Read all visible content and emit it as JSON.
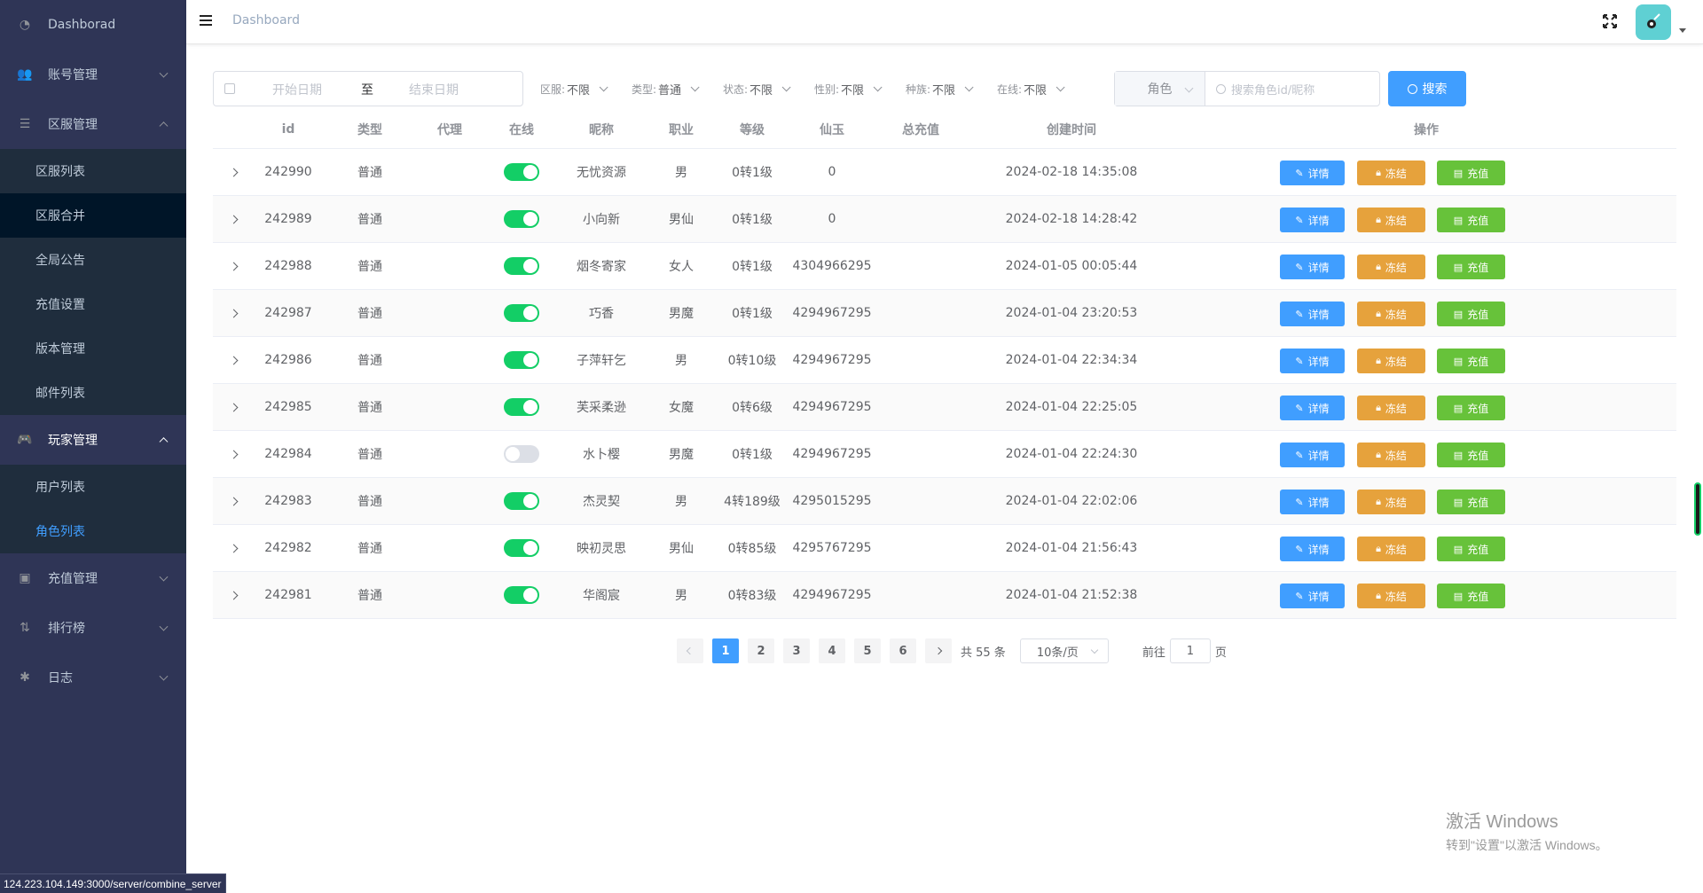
{
  "sidebar": {
    "items": [
      {
        "label": "Dashborad",
        "icon": "dashboard-icon"
      },
      {
        "label": "账号管理",
        "icon": "users-icon"
      },
      {
        "label": "区服管理",
        "icon": "server-icon"
      },
      {
        "label": "玩家管理",
        "icon": "gamepad-icon"
      },
      {
        "label": "充值管理",
        "icon": "money-icon"
      },
      {
        "label": "排行榜",
        "icon": "sort-icon"
      },
      {
        "label": "日志",
        "icon": "bug-icon"
      }
    ],
    "server_sub": [
      "区服列表",
      "区服合并",
      "全局公告",
      "充值设置",
      "版本管理",
      "邮件列表"
    ],
    "player_sub": [
      "用户列表",
      "角色列表"
    ]
  },
  "status_url": "124.223.104.149:3000/server/combine_server",
  "header": {
    "breadcrumb": "Dashboard"
  },
  "filters": {
    "date_start_placeholder": "开始日期",
    "date_sep": "至",
    "date_end_placeholder": "结束日期",
    "selects": [
      {
        "label": "区服:",
        "value": "不限"
      },
      {
        "label": "类型:",
        "value": "普通"
      },
      {
        "label": "状态:",
        "value": "不限"
      },
      {
        "label": "性别:",
        "value": "不限"
      },
      {
        "label": "种族:",
        "value": "不限"
      },
      {
        "label": "在线:",
        "value": "不限"
      }
    ],
    "role_select": "角色",
    "keyword_placeholder": "搜索角色id/昵称",
    "search_label": "搜索"
  },
  "table": {
    "headers": {
      "id": "id",
      "type": "类型",
      "agent": "代理",
      "online": "在线",
      "nick": "昵称",
      "job": "职业",
      "level": "等级",
      "jade": "仙玉",
      "total": "总充值",
      "time": "创建时间",
      "ops": "操作"
    },
    "rows": [
      {
        "id": "242990",
        "type": "普通",
        "agent": "",
        "online": true,
        "nick": "无忧资源",
        "job": "男",
        "level": "0转1级",
        "jade": "0",
        "total": "",
        "time": "2024-02-18 14:35:08"
      },
      {
        "id": "242989",
        "type": "普通",
        "agent": "",
        "online": true,
        "nick": "小向新",
        "job": "男仙",
        "level": "0转1级",
        "jade": "0",
        "total": "",
        "time": "2024-02-18 14:28:42"
      },
      {
        "id": "242988",
        "type": "普通",
        "agent": "",
        "online": true,
        "nick": "烟冬寄家",
        "job": "女人",
        "level": "0转1级",
        "jade": "4304966295",
        "total": "",
        "time": "2024-01-05 00:05:44"
      },
      {
        "id": "242987",
        "type": "普通",
        "agent": "",
        "online": true,
        "nick": "巧香",
        "job": "男魔",
        "level": "0转1级",
        "jade": "4294967295",
        "total": "",
        "time": "2024-01-04 23:20:53"
      },
      {
        "id": "242986",
        "type": "普通",
        "agent": "",
        "online": true,
        "nick": "子萍轩乞",
        "job": "男",
        "level": "0转10级",
        "jade": "4294967295",
        "total": "",
        "time": "2024-01-04 22:34:34"
      },
      {
        "id": "242985",
        "type": "普通",
        "agent": "",
        "online": true,
        "nick": "芙采柔逊",
        "job": "女魔",
        "level": "0转6级",
        "jade": "4294967295",
        "total": "",
        "time": "2024-01-04 22:25:05"
      },
      {
        "id": "242984",
        "type": "普通",
        "agent": "",
        "online": false,
        "nick": "水卜樱",
        "job": "男魔",
        "level": "0转1级",
        "jade": "4294967295",
        "total": "",
        "time": "2024-01-04 22:24:30"
      },
      {
        "id": "242983",
        "type": "普通",
        "agent": "",
        "online": true,
        "nick": "杰灵契",
        "job": "男",
        "level": "4转189级",
        "jade": "4295015295",
        "total": "",
        "time": "2024-01-04 22:02:06"
      },
      {
        "id": "242982",
        "type": "普通",
        "agent": "",
        "online": true,
        "nick": "映初灵思",
        "job": "男仙",
        "level": "0转85级",
        "jade": "4295767295",
        "total": "",
        "time": "2024-01-04 21:56:43"
      },
      {
        "id": "242981",
        "type": "普通",
        "agent": "",
        "online": true,
        "nick": "华阁宸",
        "job": "男",
        "level": "0转83级",
        "jade": "4294967295",
        "total": "",
        "time": "2024-01-04 21:52:38"
      }
    ],
    "op_labels": {
      "detail": "详情",
      "freeze": "冻结",
      "charge": "充值"
    }
  },
  "pagination": {
    "pages": [
      "1",
      "2",
      "3",
      "4",
      "5",
      "6"
    ],
    "current": "1",
    "total_text": "共 55 条",
    "page_size": "10条/页",
    "goto_prefix": "前往",
    "goto_value": "1",
    "goto_suffix": "页"
  },
  "watermark": {
    "line1": "激活 Windows",
    "line2": "转到\"设置\"以激活 Windows。"
  },
  "colors": {
    "sidebar_bg": "#2f3556",
    "primary": "#409eff",
    "warning": "#e6a23c",
    "success": "#67c23a",
    "switch_on": "#13ce66"
  }
}
